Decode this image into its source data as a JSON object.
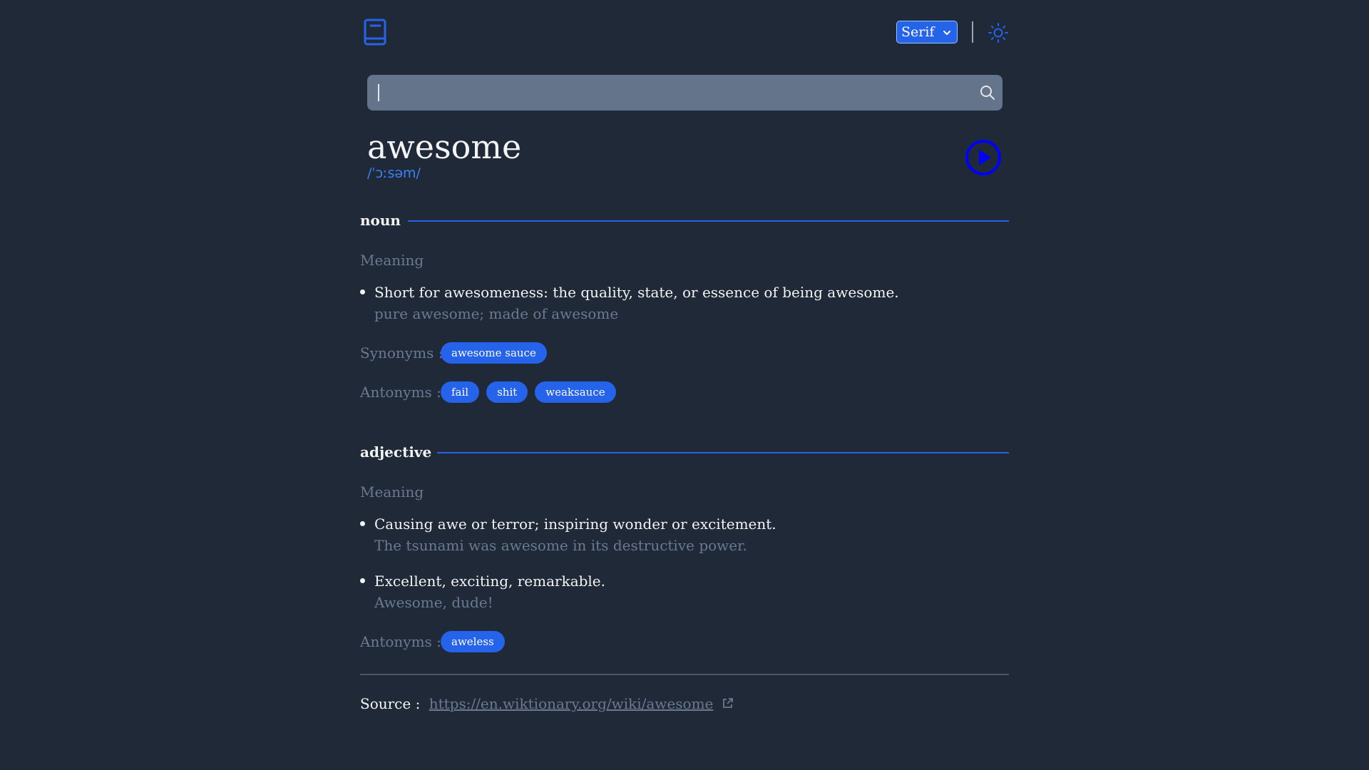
{
  "header": {
    "logo_icon": "book-icon",
    "font_select": {
      "value": "Serif",
      "options": [
        "Serif"
      ]
    },
    "theme_toggle_icon": "sun-icon"
  },
  "search": {
    "value": "",
    "placeholder": "",
    "icon": "search-icon"
  },
  "entry": {
    "word": "awesome",
    "phonetic": "/ˈɔːsəm/",
    "play_icon": "play-icon"
  },
  "meanings": [
    {
      "part_of_speech": "noun",
      "meaning_label": "Meaning",
      "definitions": [
        {
          "text": "Short for awesomeness: the quality, state, or essence of being awesome.",
          "example": "pure awesome; made of awesome"
        }
      ],
      "synonyms_label": "Synonyms :",
      "synonyms": [
        "awesome sauce"
      ],
      "antonyms_label": "Antonyms :",
      "antonyms": [
        "fail",
        "shit",
        "weaksauce"
      ]
    },
    {
      "part_of_speech": "adjective",
      "meaning_label": "Meaning",
      "definitions": [
        {
          "text": "Causing awe or terror; inspiring wonder or excitement.",
          "example": "The tsunami was awesome in its destructive power."
        },
        {
          "text": "Excellent, exciting, remarkable.",
          "example": "Awesome, dude!"
        }
      ],
      "antonyms_label": "Antonyms :",
      "antonyms": [
        "aweless"
      ]
    }
  ],
  "source": {
    "label": "Source :",
    "url": "https://en.wiktionary.org/wiki/awesome",
    "icon": "external-link-icon"
  },
  "colors": {
    "background": "#1f2937",
    "accent": "#2563eb",
    "muted": "#6b7a90"
  }
}
